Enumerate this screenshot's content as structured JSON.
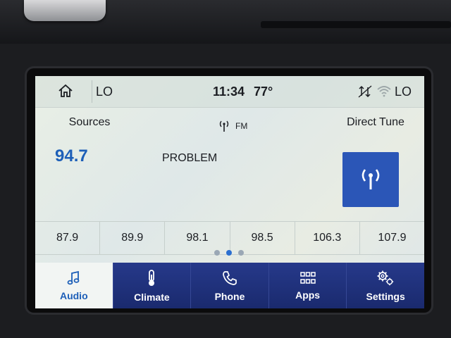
{
  "status_bar": {
    "left_label": "LO",
    "time": "11:34",
    "temperature": "77°",
    "right_label": "LO",
    "icons": [
      "home-icon",
      "signal-icon",
      "wifi-icon"
    ]
  },
  "radio": {
    "sources_label": "Sources",
    "band": "FM",
    "band_icon": "antenna-icon",
    "direct_tune_label": "Direct Tune",
    "frequency": "94.7",
    "song_text": "PROBLEM"
  },
  "presets": [
    "87.9",
    "89.9",
    "98.1",
    "98.5",
    "106.3",
    "107.9"
  ],
  "page_indicator": {
    "pages": 3,
    "active": 2
  },
  "nav": [
    {
      "label": "Audio",
      "icon": "music-note-icon",
      "active": true
    },
    {
      "label": "Climate",
      "icon": "thermometer-icon",
      "active": false
    },
    {
      "label": "Phone",
      "icon": "phone-icon",
      "active": false
    },
    {
      "label": "Apps",
      "icon": "apps-grid-icon",
      "active": false
    },
    {
      "label": "Settings",
      "icon": "gear-icon",
      "active": false
    }
  ],
  "colors": {
    "accent_blue": "#1d5fb8",
    "nav_background": "#20327a",
    "tune_button": "#2b56b7"
  }
}
